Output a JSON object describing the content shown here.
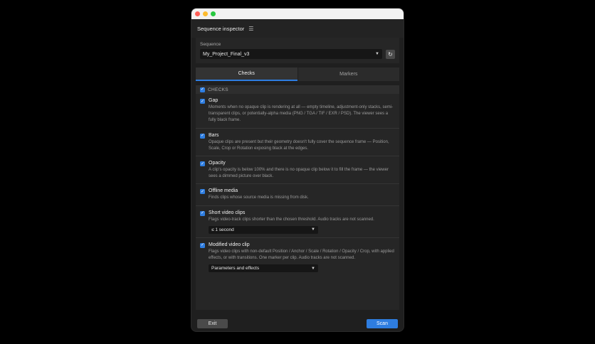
{
  "window": {
    "colors": {
      "accent": "#2e7de0",
      "close": "#ff5f57",
      "minimize": "#febc2e",
      "maximize": "#28c840"
    }
  },
  "header": {
    "title": "Sequence inspector",
    "menu_icon": "☰"
  },
  "sequence": {
    "label": "Sequence",
    "selected": "My_Project_Final_v3",
    "refresh_icon": "↻"
  },
  "tabs": [
    {
      "label": "Checks",
      "active": true
    },
    {
      "label": "Markers",
      "active": false
    }
  ],
  "checks": {
    "header_label": "CHECKS",
    "all_checked": true,
    "items": [
      {
        "title": "Gap",
        "description": "Moments when no opaque clip is rendering at all — empty timeline, adjustment-only stacks, semi-transparent clips, or potentially-alpha media (PNG / TGA / TIF / EXR / PSD). The viewer sees a fully black frame.",
        "checked": true
      },
      {
        "title": "Bars",
        "description": "Opaque clips are present but their geometry doesn't fully cover the sequence frame — Position, Scale, Crop or Rotation exposing black at the edges.",
        "checked": true
      },
      {
        "title": "Opacity",
        "description": "A clip's opacity is below 100% and there is no opaque clip below it to fill the frame — the viewer sees a dimmed picture over black.",
        "checked": true
      },
      {
        "title": "Offline media",
        "description": "Finds clips whose source media is missing from disk.",
        "checked": true
      },
      {
        "title": "Short video clips",
        "description": "Flags video-track clips shorter than the chosen threshold. Audio tracks are not scanned.",
        "checked": true,
        "select_value": "≤ 1 second"
      },
      {
        "title": "Modified video clip",
        "description": "Flags video clips with non-default Position / Anchor / Scale / Rotation / Opacity / Crop, with applied effects, or with transitions. One marker per clip. Audio tracks are not scanned.",
        "checked": true,
        "select_value": "Parameters and effects"
      }
    ]
  },
  "footer": {
    "exit_label": "Exit",
    "scan_label": "Scan"
  }
}
